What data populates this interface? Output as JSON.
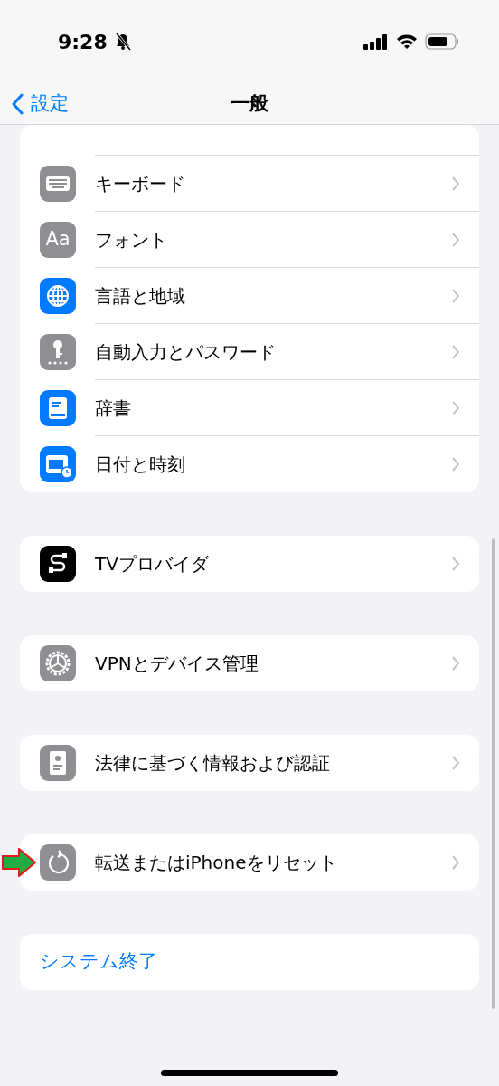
{
  "status_bar": {
    "time": "9:28",
    "silent": true
  },
  "nav": {
    "back_label": "設定",
    "title": "一般"
  },
  "groups": [
    {
      "rows": [
        {
          "kind": "item",
          "label": "キーボード",
          "color": "#8e8e93",
          "marked": false
        },
        {
          "kind": "item",
          "label": "フォント",
          "icon_text": "Aa",
          "color": "#8e8e93",
          "marked": false
        },
        {
          "kind": "item",
          "label": "言語と地域",
          "color": "#007aff",
          "marked": false
        },
        {
          "kind": "item",
          "label": "自動入力とパスワード",
          "color": "#8e8e93",
          "marked": false
        },
        {
          "kind": "item",
          "label": "辞書",
          "color": "#007aff",
          "marked": false
        },
        {
          "kind": "item",
          "label": "日付と時刻",
          "color": "#007aff",
          "marked": false
        }
      ]
    },
    {
      "rows": [
        {
          "kind": "item",
          "label": "TVプロバイダ",
          "color": "#000000",
          "marked": false
        }
      ]
    },
    {
      "rows": [
        {
          "kind": "item",
          "label": "VPNとデバイス管理",
          "color": "#8e8e93",
          "marked": false
        }
      ]
    },
    {
      "rows": [
        {
          "kind": "item",
          "label": "法律に基づく情報および認証",
          "color": "#8e8e93",
          "marked": false
        }
      ]
    },
    {
      "rows": [
        {
          "kind": "item",
          "label": "転送またはiPhoneをリセット",
          "color": "#8e8e93",
          "marked": true
        }
      ]
    },
    {
      "rows": [
        {
          "kind": "action",
          "label": "システム終了"
        }
      ]
    }
  ]
}
